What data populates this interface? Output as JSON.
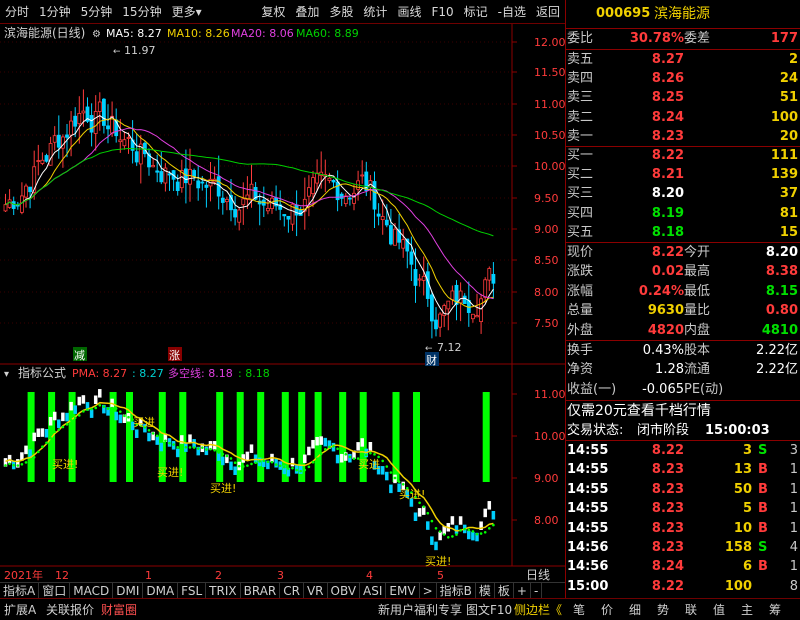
{
  "toolbar": {
    "items": [
      "分时",
      "1分钟",
      "5分钟",
      "15分钟",
      "更多"
    ],
    "more_arrow": "▾",
    "right_items": [
      "复权",
      "叠加",
      "多股",
      "统计",
      "画线",
      "F10",
      "标记",
      "-自选",
      "返回"
    ]
  },
  "stock": {
    "code": "000695",
    "name": "滨海能源"
  },
  "chart_header": {
    "title": "滨海能源(日线)",
    "ma5": "MA5: 8.27",
    "ma10": "MA10: 8.26",
    "ma20": "MA20: 8.06",
    "ma60": "MA60: 8.89"
  },
  "price_axis": [
    "12.00",
    "11.50",
    "11.00",
    "10.50",
    "10.00",
    "9.50",
    "9.00",
    "8.50",
    "8.00",
    "7.50"
  ],
  "price_high_label": "11.97",
  "price_low_label": "7.12",
  "markers": {
    "jian": "减",
    "zhang": "涨",
    "cai": "财"
  },
  "indicator_header": {
    "title": "指标公式",
    "pma": "PMA: 8.27",
    "val2": ": 8.27",
    "kong": "多空线: 8.18",
    "val4": ": 8.18"
  },
  "indicator_axis": [
    "11.00",
    "10.00",
    "9.00",
    "8.00"
  ],
  "buy_label": "买进",
  "date_axis": {
    "year": "2021年",
    "labels": [
      "12",
      "1",
      "2",
      "3",
      "4",
      "5"
    ]
  },
  "tabs": [
    "指标A",
    "窗口",
    "MACD",
    "DMI",
    "DMA",
    "FSL",
    "TRIX",
    "BRAR",
    "CR",
    "VR",
    "OBV",
    "ASI",
    "EMV",
    ">",
    "指标B",
    "模",
    "板"
  ],
  "tabs_right": [
    "日线",
    "+",
    "-"
  ],
  "quote": {
    "webi_label": "委比",
    "webi": "30.78%",
    "weicha_label": "委差",
    "weicha": "177",
    "asks": [
      {
        "label": "卖五",
        "price": "8.27",
        "vol": "2"
      },
      {
        "label": "卖四",
        "price": "8.26",
        "vol": "24"
      },
      {
        "label": "卖三",
        "price": "8.25",
        "vol": "51"
      },
      {
        "label": "卖二",
        "price": "8.24",
        "vol": "100"
      },
      {
        "label": "卖一",
        "price": "8.23",
        "vol": "20"
      }
    ],
    "bids": [
      {
        "label": "买一",
        "price": "8.22",
        "vol": "111"
      },
      {
        "label": "买二",
        "price": "8.21",
        "vol": "139"
      },
      {
        "label": "买三",
        "price": "8.20",
        "vol": "37"
      },
      {
        "label": "买四",
        "price": "8.19",
        "vol": "81"
      },
      {
        "label": "买五",
        "price": "8.18",
        "vol": "15"
      }
    ],
    "stats": [
      {
        "l1": "现价",
        "v1": "8.22",
        "l2": "今开",
        "v2": "8.20"
      },
      {
        "l1": "涨跌",
        "v1": "0.02",
        "l2": "最高",
        "v2": "8.38"
      },
      {
        "l1": "涨幅",
        "v1": "0.24%",
        "l2": "最低",
        "v2": "8.15"
      },
      {
        "l1": "总量",
        "v1": "9630",
        "l2": "量比",
        "v2": "0.80"
      },
      {
        "l1": "外盘",
        "v1": "4820",
        "l2": "内盘",
        "v2": "4810"
      }
    ],
    "stats2": [
      {
        "l1": "换手",
        "v1": "0.43%",
        "l2": "股本",
        "v2": "2.22亿"
      },
      {
        "l1": "净资",
        "v1": "1.28",
        "l2": "流通",
        "v2": "2.22亿"
      },
      {
        "l1": "收益(一)",
        "v1": "-0.065",
        "l2": "PE(动)",
        "v2": ""
      }
    ],
    "promo": "仅需20元查看千档行情",
    "status_label": "交易状态:",
    "status": "闭市阶段",
    "status_time": "15:00:03",
    "ticks": [
      {
        "t": "14:55",
        "p": "8.22",
        "v": "3",
        "bs": "S",
        "n": "3"
      },
      {
        "t": "14:55",
        "p": "8.23",
        "v": "13",
        "bs": "B",
        "n": "1"
      },
      {
        "t": "14:55",
        "p": "8.23",
        "v": "50",
        "bs": "B",
        "n": "1"
      },
      {
        "t": "14:55",
        "p": "8.23",
        "v": "5",
        "bs": "B",
        "n": "1"
      },
      {
        "t": "14:55",
        "p": "8.23",
        "v": "10",
        "bs": "B",
        "n": "1"
      },
      {
        "t": "14:56",
        "p": "8.23",
        "v": "158",
        "bs": "S",
        "n": "4"
      },
      {
        "t": "14:56",
        "p": "8.24",
        "v": "6",
        "bs": "B",
        "n": "1"
      },
      {
        "t": "15:00",
        "p": "8.22",
        "v": "100",
        "bs": "",
        "n": "8"
      }
    ]
  },
  "bottom": {
    "left": [
      "扩展A",
      "关联报价",
      "财富圈"
    ],
    "mid": [
      "新用户福利专享",
      "图文F10",
      "侧边栏《"
    ],
    "right": [
      "笔",
      "价",
      "细",
      "势",
      "联",
      "值",
      "主",
      "筹"
    ]
  },
  "colors": {
    "up": "#ff3b3b",
    "down": "#00e000",
    "ma5": "#ffffff",
    "ma10": "#f0d000",
    "ma20": "#e040e0",
    "ma60": "#00d000"
  }
}
